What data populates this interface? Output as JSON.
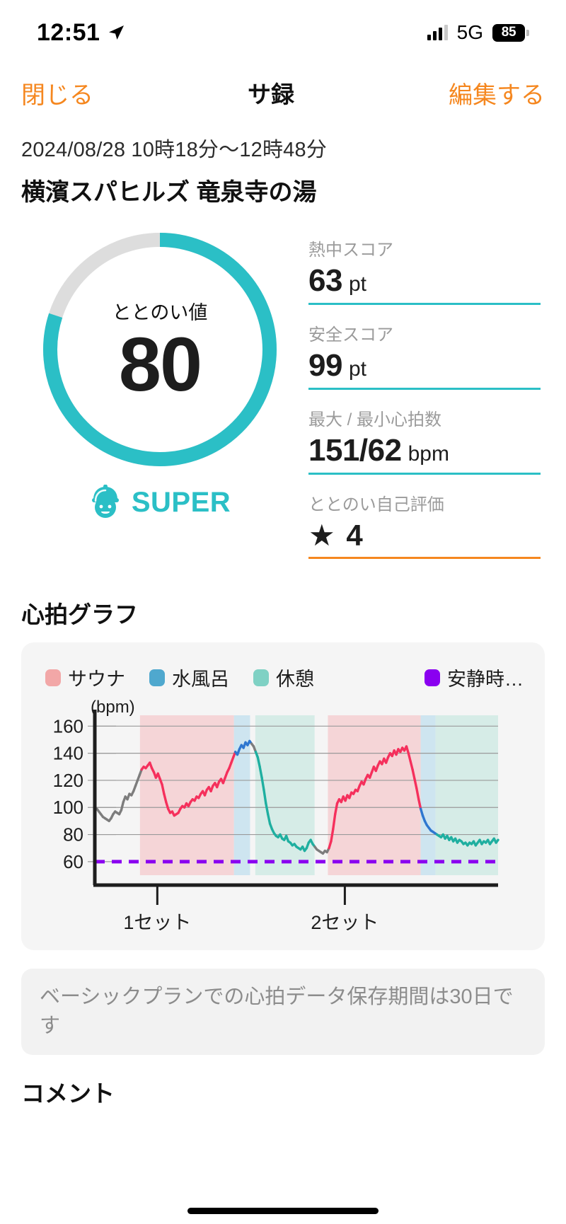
{
  "status_bar": {
    "time": "12:51",
    "location_icon": "location-arrow-icon",
    "signal_icon": "cellular-signal-icon",
    "network": "5G",
    "battery_level": "85"
  },
  "nav": {
    "close_label": "閉じる",
    "title": "サ録",
    "edit_label": "編集する"
  },
  "header": {
    "date_range": "2024/08/28 10時18分〜12時48分",
    "venue": "横濱スパヒルズ 竜泉寺の湯"
  },
  "gauge": {
    "label": "ととのい値",
    "value": "80",
    "percent": 80,
    "arc_color": "#2BBFC6",
    "track_color": "#DDDDDD",
    "rank_label": "SUPER",
    "rank_icon": "sauna-hat-character-icon",
    "rank_color": "#2BBFC6"
  },
  "stats": [
    {
      "label": "熱中スコア",
      "value": "63",
      "unit": "pt",
      "rule": "#2BBFC6"
    },
    {
      "label": "安全スコア",
      "value": "99",
      "unit": "pt",
      "rule": "#2BBFC6"
    },
    {
      "label": "最大 / 最小心拍数",
      "value": "151/62",
      "unit": "bpm",
      "rule": "#2BBFC6"
    },
    {
      "label": "ととのい自己評価",
      "value": "★ 4",
      "unit": "",
      "rule": "#F5871F"
    }
  ],
  "chart_section": {
    "title": "心拍グラフ"
  },
  "chart_data": {
    "type": "line",
    "title": "心拍グラフ",
    "ylabel": "(bpm)",
    "xlabel": "",
    "ylim": [
      50,
      168
    ],
    "yticks": [
      60,
      80,
      100,
      120,
      140,
      160
    ],
    "ytick_labels": [
      "60",
      "80",
      "100",
      "120",
      "140",
      "160"
    ],
    "grid": true,
    "legend_position": "top",
    "legend": [
      {
        "name": "サウナ",
        "color": "#F2A7A7"
      },
      {
        "name": "水風呂",
        "color": "#4FA8CE"
      },
      {
        "name": "休憩",
        "color": "#7FD1C4"
      },
      {
        "name": "安静時…",
        "color": "#8A00F0"
      }
    ],
    "resting_hr": 60,
    "resting_line_color": "#8A00F0",
    "xticks": [
      {
        "label": "1セット",
        "x": 0.155
      },
      {
        "label": "2セット",
        "x": 0.62
      }
    ],
    "bands": [
      {
        "type": "サウナ",
        "color": "#F5C9CC",
        "x0": 0.112,
        "x1": 0.345
      },
      {
        "type": "水風呂",
        "color": "#BFDFEF",
        "x0": 0.345,
        "x1": 0.385
      },
      {
        "type": "休憩",
        "color": "#CBE9E2",
        "x0": 0.398,
        "x1": 0.545
      },
      {
        "type": "サウナ",
        "color": "#F5C9CC",
        "x0": 0.578,
        "x1": 0.808
      },
      {
        "type": "水風呂",
        "color": "#BFDFEF",
        "x0": 0.808,
        "x1": 0.845
      },
      {
        "type": "休憩",
        "color": "#CBE9E2",
        "x0": 0.845,
        "x1": 1.0
      }
    ],
    "series": [
      {
        "name": "心拍数",
        "segment_colors": {
          "idle": "#7D7D7D",
          "sauna": "#F5305C",
          "mizuburo": "#2E77D0",
          "kyukei": "#1FAFA0"
        },
        "values": [
          100,
          99,
          97,
          95,
          93,
          92,
          91,
          90,
          92,
          95,
          97,
          96,
          95,
          98,
          104,
          108,
          106,
          110,
          109,
          112,
          116,
          120,
          124,
          128,
          130,
          129,
          131,
          133,
          129,
          126,
          122,
          125,
          121,
          117,
          110,
          104,
          99,
          96,
          97,
          94,
          95,
          96,
          99,
          101,
          100,
          103,
          101,
          104,
          106,
          105,
          108,
          107,
          110,
          112,
          109,
          113,
          115,
          112,
          116,
          118,
          115,
          119,
          121,
          118,
          122,
          126,
          129,
          133,
          137,
          141,
          139,
          143,
          146,
          144,
          148,
          146,
          149,
          147,
          145,
          141,
          137,
          130,
          122,
          113,
          103,
          95,
          88,
          84,
          81,
          79,
          78,
          80,
          77,
          76,
          79,
          75,
          74,
          72,
          73,
          71,
          70,
          69,
          71,
          68,
          70,
          74,
          76,
          73,
          71,
          69,
          68,
          67,
          66,
          68,
          67,
          70,
          75,
          84,
          95,
          103,
          106,
          104,
          108,
          105,
          109,
          107,
          111,
          110,
          113,
          112,
          116,
          119,
          117,
          121,
          124,
          122,
          126,
          130,
          127,
          131,
          134,
          132,
          136,
          133,
          137,
          140,
          138,
          142,
          139,
          143,
          141,
          144,
          142,
          145,
          140,
          134,
          128,
          121,
          114,
          106,
          99,
          94,
          90,
          87,
          85,
          83,
          82,
          81,
          80,
          79,
          78,
          80,
          77,
          79,
          76,
          78,
          75,
          77,
          74,
          76,
          75,
          73,
          74,
          72,
          74,
          73,
          75,
          72,
          74,
          76,
          73,
          75,
          74,
          76,
          73,
          75,
          77,
          74,
          76
        ]
      }
    ]
  },
  "notice": {
    "text": "ベーシックプランでの心拍データ保存期間は30日です"
  },
  "comment_section": {
    "title": "コメント"
  }
}
